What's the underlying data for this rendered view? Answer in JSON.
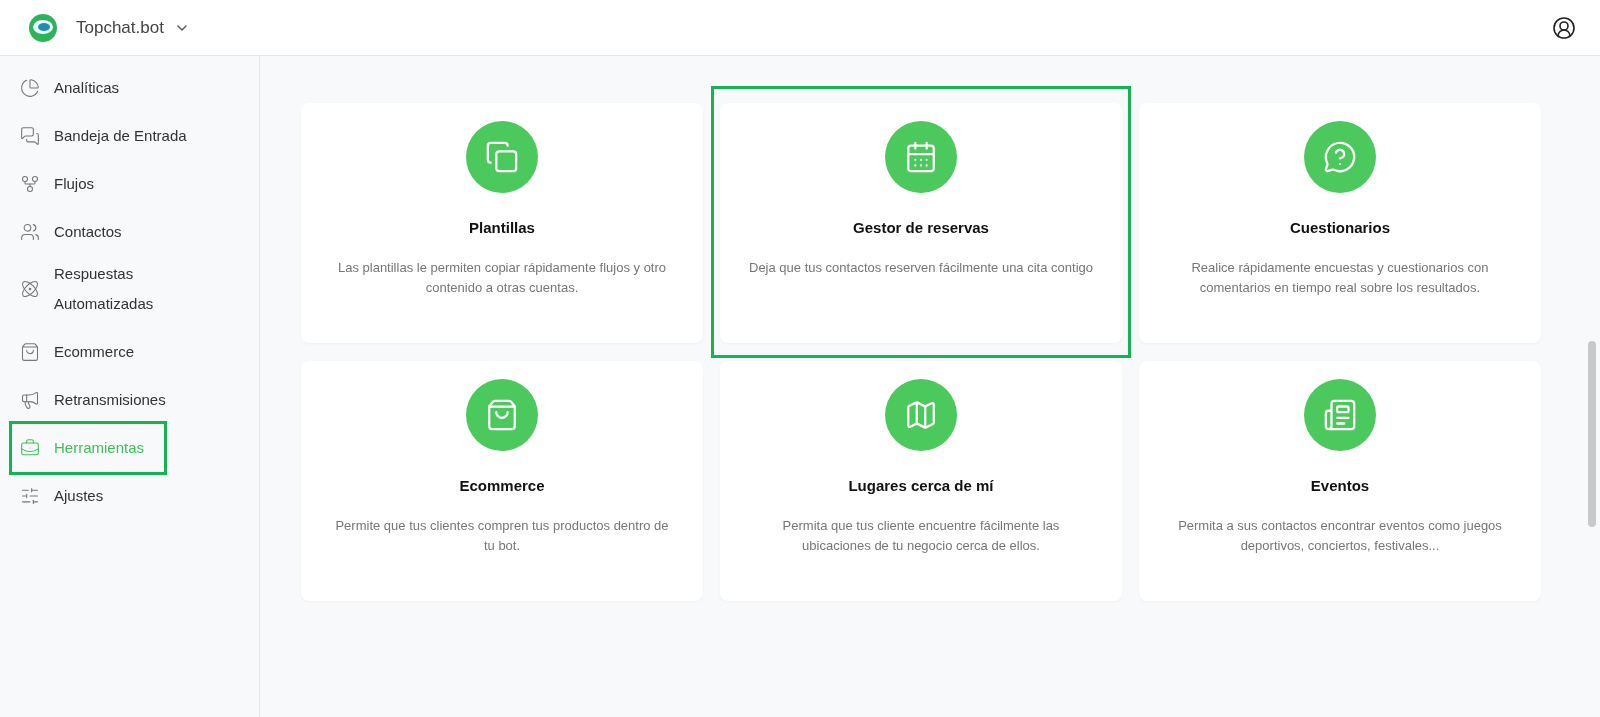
{
  "header": {
    "brand": "Topchat.bot"
  },
  "sidebar": {
    "items": [
      {
        "label": "Analíticas",
        "selected": false,
        "highlighted": false
      },
      {
        "label": "Bandeja de Entrada",
        "selected": false,
        "highlighted": false
      },
      {
        "label": "Flujos",
        "selected": false,
        "highlighted": false
      },
      {
        "label": "Contactos",
        "selected": false,
        "highlighted": false
      },
      {
        "label": "Respuestas Automatizadas",
        "selected": false,
        "highlighted": false
      },
      {
        "label": "Ecommerce",
        "selected": false,
        "highlighted": false
      },
      {
        "label": "Retransmisiones",
        "selected": false,
        "highlighted": false
      },
      {
        "label": "Herramientas",
        "selected": true,
        "highlighted": true
      },
      {
        "label": "Ajustes",
        "selected": false,
        "highlighted": false
      }
    ]
  },
  "tools": [
    {
      "title": "Plantillas",
      "description": "Las plantillas le permiten copiar rápidamente flujos y otro contenido a otras cuentas.",
      "highlighted": false
    },
    {
      "title": "Gestor de reservas",
      "description": "Deja que tus contactos reserven fácilmente una cita contigo",
      "highlighted": true
    },
    {
      "title": "Cuestionarios",
      "description": "Realice rápidamente encuestas y cuestionarios con comentarios en tiempo real sobre los resultados.",
      "highlighted": false
    },
    {
      "title": "Ecommerce",
      "description": "Permite que tus clientes compren tus productos dentro de tu bot.",
      "highlighted": false
    },
    {
      "title": "Lugares cerca de mí",
      "description": "Permita que tus cliente encuentre fácilmente las ubicaciones de tu negocio cerca de ellos.",
      "highlighted": false
    },
    {
      "title": "Eventos",
      "description": "Permita a sus contactos encontrar eventos como juegos deportivos, conciertos, festivales...",
      "highlighted": false
    }
  ]
}
